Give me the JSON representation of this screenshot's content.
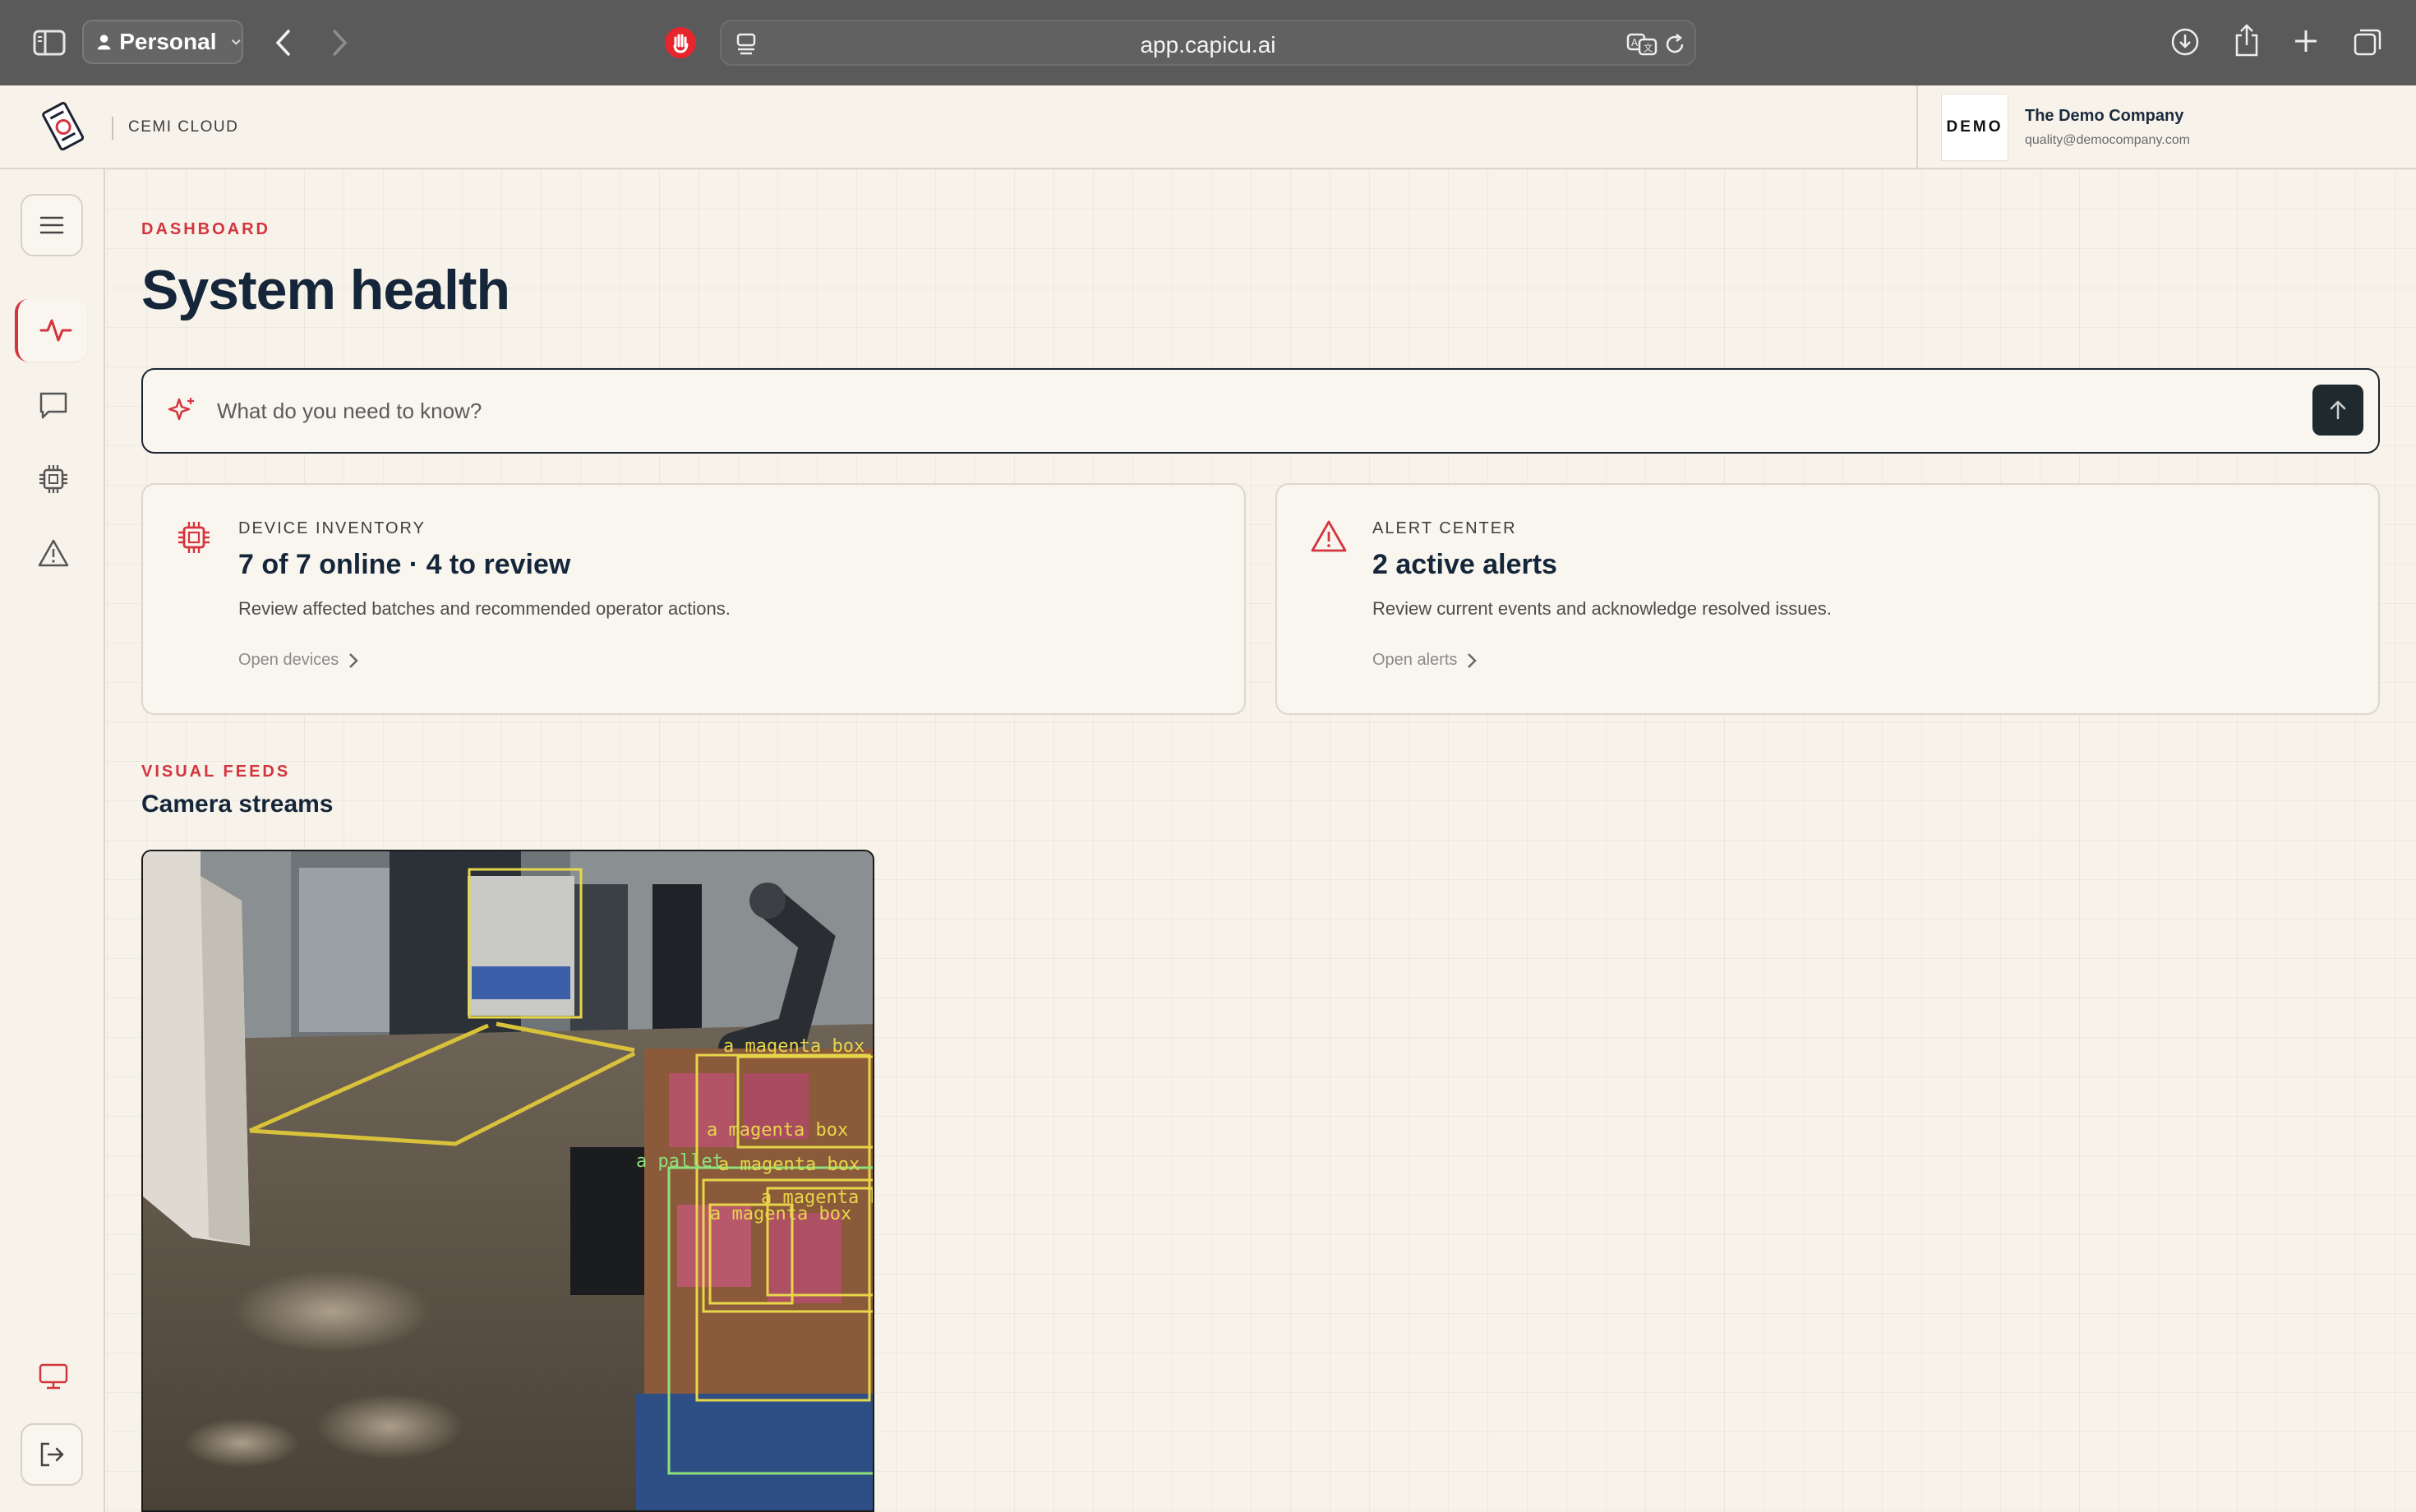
{
  "browser": {
    "profile_label": "Personal",
    "url": "app.capicu.ai"
  },
  "app": {
    "brand": "CEMI CLOUD"
  },
  "account": {
    "logo_text": "DEMO",
    "company": "The Demo Company",
    "email": "quality@democompany.com"
  },
  "sidebar": {
    "items": [
      {
        "name": "menu",
        "icon": "menu-icon"
      },
      {
        "name": "health",
        "icon": "activity-icon",
        "active": true
      },
      {
        "name": "chat",
        "icon": "chat-icon"
      },
      {
        "name": "devices",
        "icon": "chip-icon"
      },
      {
        "name": "alerts",
        "icon": "warning-icon"
      },
      {
        "name": "display",
        "icon": "monitor-icon"
      },
      {
        "name": "logout",
        "icon": "logout-icon"
      }
    ]
  },
  "dashboard": {
    "eyebrow": "DASHBOARD",
    "title": "System health",
    "ask_placeholder": "What do you need to know?"
  },
  "cards": {
    "devices": {
      "kicker": "DEVICE INVENTORY",
      "headline": "7 of 7 online · 4 to review",
      "description": "Review affected batches and recommended operator actions.",
      "link": "Open devices"
    },
    "alerts": {
      "kicker": "ALERT CENTER",
      "headline": "2 active alerts",
      "description": "Review current events and acknowledge resolved issues.",
      "link": "Open alerts"
    }
  },
  "feeds": {
    "eyebrow": "VISUAL FEEDS",
    "title": "Camera streams",
    "detections": [
      "a magenta box",
      "a magenta box",
      "a pallet",
      "a magenta box",
      "a magenta box",
      "a magenta box"
    ]
  },
  "colors": {
    "accent": "#d4343d",
    "navy": "#15263a",
    "background": "#f7f3ea",
    "detection_yellow": "#e8d64a",
    "detection_green": "#8fe07a"
  }
}
